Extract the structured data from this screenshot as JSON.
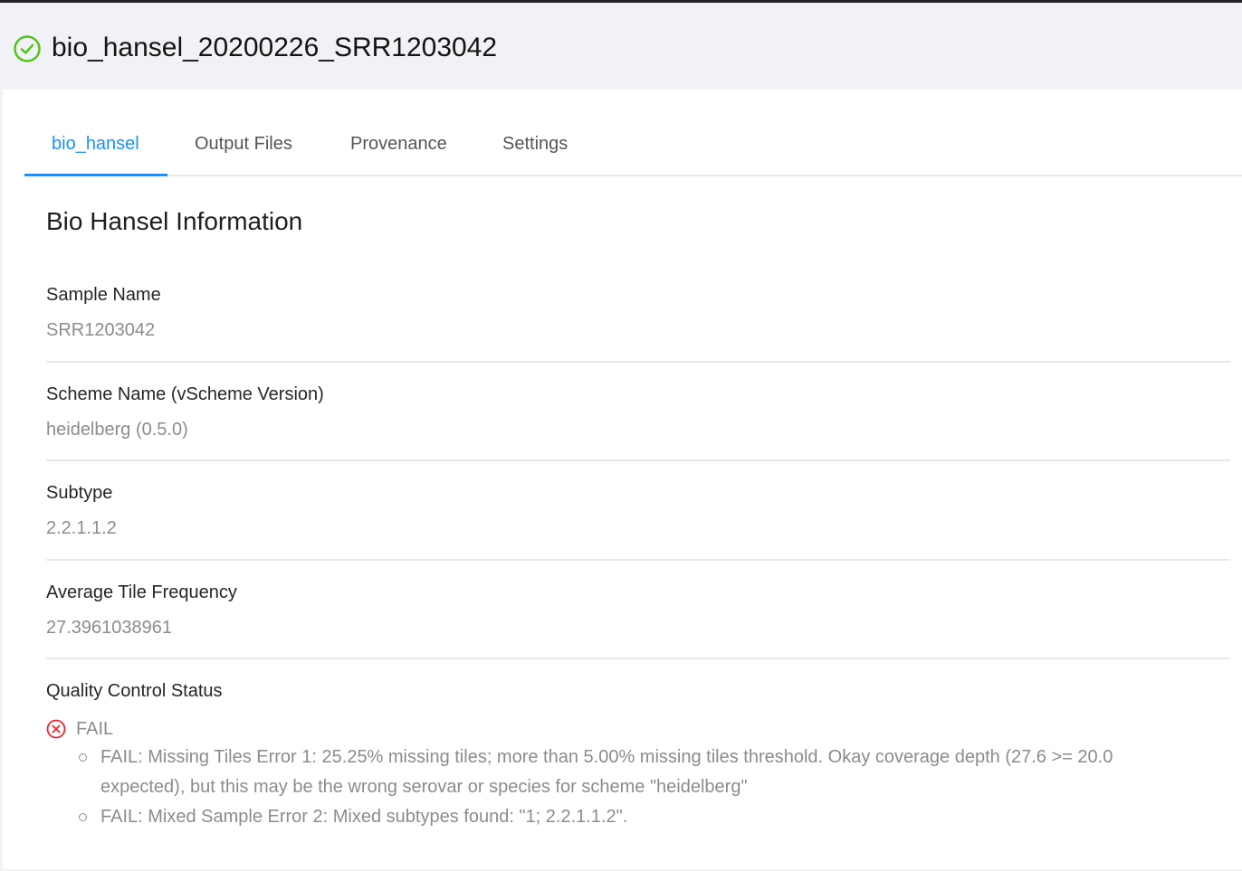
{
  "header": {
    "title": "bio_hansel_20200226_SRR1203042",
    "status_icon": "check-circle-icon",
    "status_color": "#52c41a"
  },
  "tabs": [
    {
      "label": "bio_hansel",
      "active": true
    },
    {
      "label": "Output Files",
      "active": false
    },
    {
      "label": "Provenance",
      "active": false
    },
    {
      "label": "Settings",
      "active": false
    }
  ],
  "section": {
    "title": "Bio Hansel Information"
  },
  "fields": [
    {
      "label": "Sample Name",
      "value": "SRR1203042"
    },
    {
      "label": "Scheme Name (vScheme Version)",
      "value": "heidelberg (0.5.0)"
    },
    {
      "label": "Subtype",
      "value": "2.2.1.1.2"
    },
    {
      "label": "Average Tile Frequency",
      "value": "27.3961038961"
    }
  ],
  "qc": {
    "label": "Quality Control Status",
    "status": "FAIL",
    "status_icon": "close-circle-icon",
    "status_color": "#f5222d",
    "messages": [
      "FAIL: Missing Tiles Error 1: 25.25% missing tiles; more than 5.00% missing tiles threshold. Okay coverage depth (27.6 >= 20.0 expected), but this may be the wrong serovar or species for scheme \"heidelberg\"",
      "FAIL: Mixed Sample Error 2: Mixed subtypes found: \"1; 2.2.1.1.2\"."
    ]
  },
  "colors": {
    "accent": "#1890ff",
    "muted_text": "#8c8c8c"
  }
}
